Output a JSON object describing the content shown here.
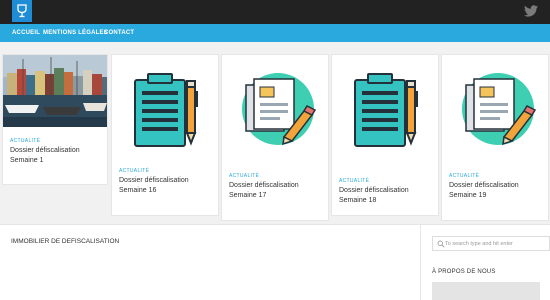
{
  "nav": {
    "items": [
      "ACCUEIL",
      "MENTIONS LÉGALES",
      "CONTACT"
    ]
  },
  "cards": [
    {
      "category": "ACTUALITÉ",
      "title": "Dossier défiscalisation Semaine 1",
      "image": "harbor-photo"
    },
    {
      "category": "ACTUALITÉ",
      "title": "Dossier défiscalisation Semaine 16",
      "image": "clipboard-pen"
    },
    {
      "category": "ACTUALITÉ",
      "title": "Dossier défiscalisation Semaine 17",
      "image": "documents-pencil"
    },
    {
      "category": "ACTUALITÉ",
      "title": "Dossier défiscalisation Semaine 18",
      "image": "clipboard-pen"
    },
    {
      "category": "ACTUALITÉ",
      "title": "Dossier défiscalisation Semaine 19",
      "image": "documents-pencil"
    }
  ],
  "main": {
    "section_title": "IMMOBILIER DE DEFISCALISATION"
  },
  "sidebar": {
    "search_placeholder": "To search type and hit enter",
    "about_title": "À PROPOS DE NOUS"
  },
  "colors": {
    "topbar": "#222222",
    "navbar": "#2aa9de",
    "accent": "#2aa9de",
    "teal": "#3ecfb2"
  },
  "icons": [
    "wine-glass-icon",
    "twitter-icon",
    "search-icon"
  ]
}
